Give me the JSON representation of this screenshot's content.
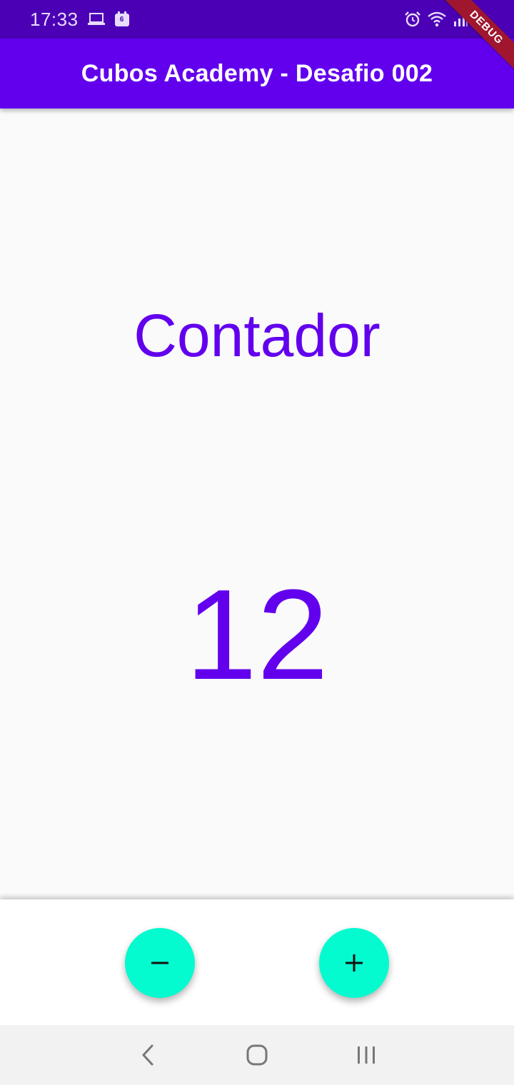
{
  "status_bar": {
    "time": "17:33",
    "left_icons": [
      "laptop-icon",
      "calendar-icon"
    ],
    "calendar_day": "6",
    "right_icons": [
      "alarm-icon",
      "wifi-icon",
      "signal-icon",
      "battery-icon"
    ]
  },
  "debug_banner": {
    "label": "DEBUG",
    "color": "#a0162e"
  },
  "app_bar": {
    "title": "Cubos Academy - Desafio 002",
    "color": "#6200ee"
  },
  "main": {
    "title": "Contador",
    "counter_value": "12",
    "text_color": "#6200ee"
  },
  "actions": {
    "decrement_icon": "minus-icon",
    "increment_icon": "plus-icon",
    "fab_color": "#03fbcf"
  },
  "nav_bar": {
    "buttons": [
      "back-icon",
      "home-icon",
      "recents-icon"
    ]
  }
}
